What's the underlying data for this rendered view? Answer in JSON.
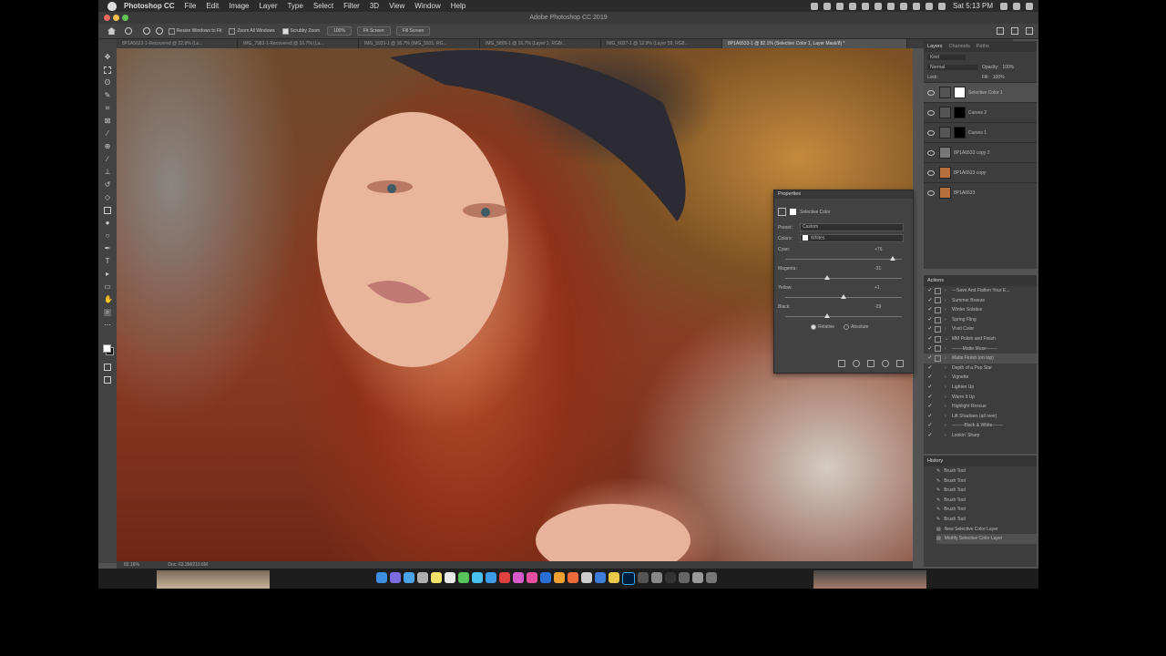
{
  "menubar": {
    "items": [
      "Photoshop CC",
      "File",
      "Edit",
      "Image",
      "Layer",
      "Type",
      "Select",
      "Filter",
      "3D",
      "View",
      "Window",
      "Help"
    ],
    "clock": "Sat 5:13 PM"
  },
  "window_title": "Adobe Photoshop CC 2019",
  "options_bar": {
    "resize_windows": "Resize Windows to Fit",
    "zoom_all": "Zoom All Windows",
    "scrubby_zoom": "Scrubby Zoom",
    "zoom_value": "100%",
    "fit_screen_1": "Fit Screen",
    "fit_screen_2": "Fill Screen"
  },
  "tabs": [
    "8P1A5622-1-Recovered @ 22.9% (La...",
    "IMG_7982-1-Recovered @ 16.7% (La...",
    "IMG_5931-1 @ 16.7% (IMG_5931, RG...",
    "IMG_5809-1 @ 16.7% (Layer 1, RG8/...",
    "IMG_6027-1 @ 12.9% (Layer 59, RG8...",
    "8P1A6533-1 @ 82.1% (Selective Color 1, Layer Mask/8) *"
  ],
  "status": {
    "zoom": "82.16%",
    "doc": "Doc: 63.3M/210.6M"
  },
  "layers_panel": {
    "tabs": [
      "Layers",
      "Channels",
      "Paths"
    ],
    "kind": "Kind",
    "blend": "Normal",
    "opacity_label": "Opacity:",
    "opacity": "100%",
    "lock_label": "Lock:",
    "fill_label": "Fill:",
    "fill": "100%",
    "layers": [
      {
        "name": "Selective Color 1",
        "selected": true
      },
      {
        "name": "Curves 2",
        "selected": false
      },
      {
        "name": "Curves 1",
        "selected": false
      },
      {
        "name": "8P1A6533 copy 2",
        "selected": false
      },
      {
        "name": "8P1A6533 copy",
        "selected": false
      },
      {
        "name": "8P1A6533",
        "selected": false
      }
    ]
  },
  "actions_panel": {
    "title": "Actions",
    "items": [
      "---Save And Flatten Your E...",
      "Summer Breeze",
      "Winter Solstice",
      "Spring Fling",
      "Vivid Color",
      "MM Polish and Finish",
      "-------Matte Muse-------",
      "Matte Finish (on top)",
      "Depth of a Pop Star",
      "Vignette",
      "Lighten Up",
      "Warm It Up",
      "Highlight Rescue",
      "Lift Shadows (all over)",
      "--------Black & White-------",
      "Lookin' Sharp"
    ]
  },
  "history_panel": {
    "title": "History",
    "items": [
      "Brush Tool",
      "Brush Tool",
      "Brush Tool",
      "Brush Tool",
      "Brush Tool",
      "Brush Tool",
      "New Selective Color Layer",
      "Modify Selective Color Layer"
    ]
  },
  "properties": {
    "title": "Properties",
    "type": "Selective Color",
    "preset_label": "Preset:",
    "preset": "Custom",
    "colors_label": "Colors:",
    "colors": "Whites",
    "sliders": [
      {
        "label": "Cyan:",
        "value": "+76",
        "pct": 0.92
      },
      {
        "label": "Magenta:",
        "value": "-31",
        "pct": 0.36
      },
      {
        "label": "Yellow:",
        "value": "+1",
        "pct": 0.5
      },
      {
        "label": "Black:",
        "value": "-29",
        "pct": 0.36
      }
    ],
    "relative": "Relative",
    "absolute": "Absolute"
  }
}
